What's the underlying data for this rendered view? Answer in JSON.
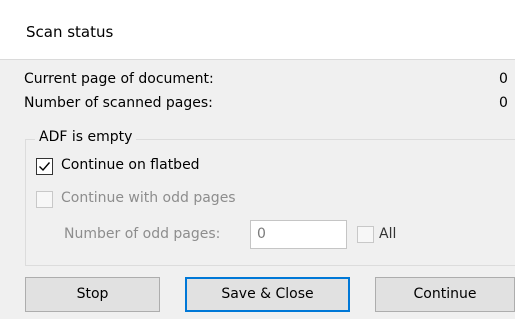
{
  "window": {
    "title": "Scan status"
  },
  "status": {
    "current_page_label": "Current page of document:",
    "current_page_value": "0",
    "scanned_pages_label": "Number of scanned pages:",
    "scanned_pages_value": "0"
  },
  "adf_group": {
    "legend": "ADF is empty",
    "continue_on_flatbed": {
      "label": "Continue on flatbed",
      "checked": true
    },
    "continue_with_odd_pages": {
      "label": "Continue with odd pages",
      "checked": false,
      "enabled": false
    },
    "odd_pages": {
      "label": "Number of odd pages:",
      "value": "0",
      "enabled": false
    },
    "all": {
      "label": "All",
      "checked": false,
      "enabled": false
    }
  },
  "buttons": {
    "stop": "Stop",
    "save_close": "Save & Close",
    "continue": "Continue"
  },
  "colors": {
    "default_button_border": "#0078d7",
    "disabled_text": "#8d8d8d"
  }
}
